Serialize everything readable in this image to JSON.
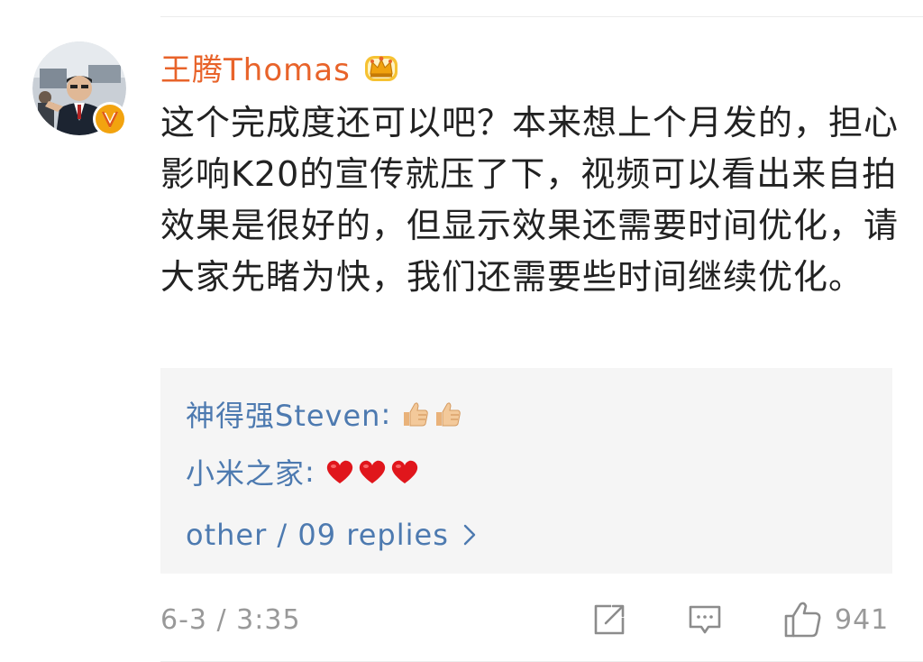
{
  "comment": {
    "author": {
      "name": "王腾Thomas",
      "name_color": "#e8632a",
      "avatar_icon": "avatar",
      "verified_icon": "verified-v-badge-icon",
      "member_icon": "crown-icon"
    },
    "text": "这个完成度还可以吧？本来想上个月发的，担心影响K20的宣传就压了下，视频可以看出来自拍效果是很好的，但显示效果还需要时间优化，请大家先睹为快，我们还需要些时间继续优化。",
    "replies": [
      {
        "author": "神得强Steven",
        "separator": ":",
        "emojis": [
          "thumbs-up-icon",
          "thumbs-up-icon"
        ]
      },
      {
        "author": "小米之家",
        "separator": ":",
        "emojis": [
          "heart-icon",
          "heart-icon",
          "heart-icon"
        ]
      }
    ],
    "more_replies_label": "other / 09 replies",
    "timestamp": "6-3 / 3:35",
    "actions": {
      "share_icon": "share-icon",
      "comment_icon": "comment-icon",
      "like_icon": "thumbs-up-icon",
      "like_count": "941"
    }
  },
  "colors": {
    "link_blue": "#4d7ab0",
    "body_text": "#222222",
    "muted": "#999999",
    "reply_bg": "#f5f5f5"
  }
}
